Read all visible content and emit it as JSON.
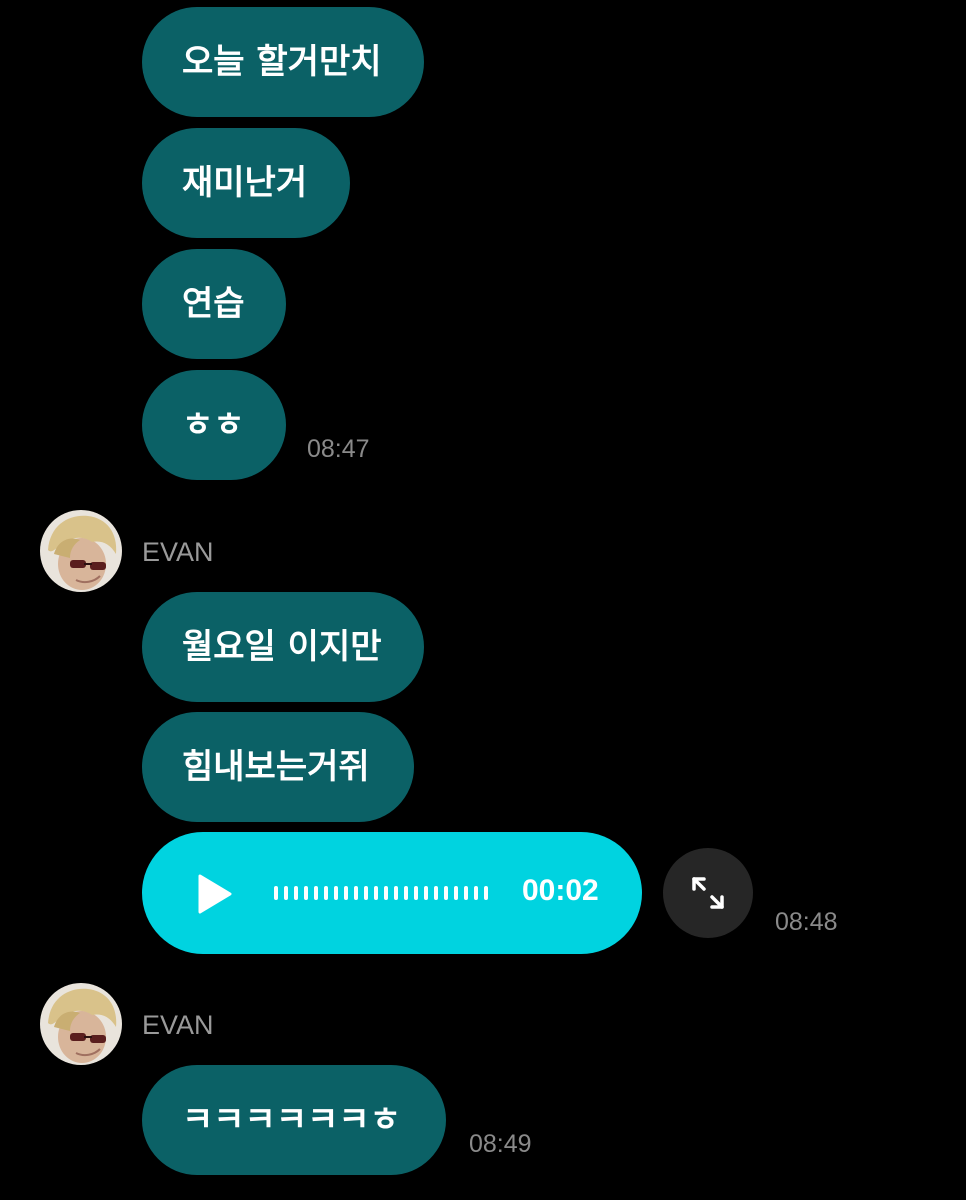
{
  "messages_block_1": {
    "items": [
      {
        "text": "오늘 할거만치"
      },
      {
        "text": "재미난거"
      },
      {
        "text": "연습"
      },
      {
        "text": "ㅎㅎ"
      }
    ],
    "time": "08:47"
  },
  "messages_block_2": {
    "sender": "EVAN",
    "items": [
      {
        "text": "월요일 이지만"
      },
      {
        "text": "힘내보는거쥐"
      }
    ],
    "voice_message": {
      "duration": "00:02",
      "play_icon": "play-icon",
      "waveform_icon": "waveform-icon"
    },
    "expand_icon": "expand-icon",
    "time": "08:48"
  },
  "messages_block_3": {
    "sender": "EVAN",
    "items": [
      {
        "text": "ㅋㅋㅋㅋㅋㅋㅎ"
      }
    ],
    "time": "08:49"
  },
  "colors": {
    "background": "#000000",
    "bubble": "#0b6166",
    "voice_bubble": "#00d3e0",
    "timestamp": "#8a8a8a",
    "sender_name": "#9a9a9a"
  }
}
